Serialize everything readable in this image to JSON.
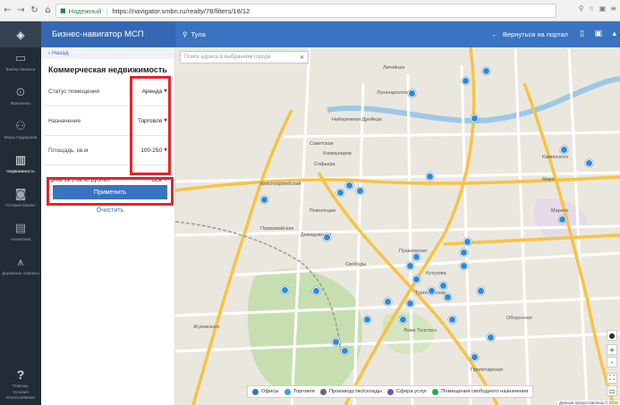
{
  "browser": {
    "secure_label": "Надежный",
    "url": "https://navigator.smbn.ru/realty/78/filters/18/12"
  },
  "rail": {
    "items": [
      {
        "label": "Выбор бизнеса",
        "icon": "briefcase-icon"
      },
      {
        "label": "Франшизы",
        "icon": "franchise-icon"
      },
      {
        "label": "Меры поддержки",
        "icon": "support-icon"
      },
      {
        "label": "Недвижимость",
        "icon": "building-icon"
      },
      {
        "label": "Готовый бизнес",
        "icon": "ready-business-icon"
      },
      {
        "label": "Аналитика",
        "icon": "analytics-icon"
      },
      {
        "label": "Дорожные сервисы",
        "icon": "road-icon"
      }
    ],
    "help_label": "Помощь",
    "terms_label": "Условия использования"
  },
  "appbar": {
    "title": "Бизнес-навигатор МСП",
    "city": "Тула",
    "back_label": "Вернуться на портал"
  },
  "panel": {
    "back_label": "Назад",
    "heading": "Коммерческая недвижимость",
    "filters": [
      {
        "label": "Статус помещения",
        "value": "Аренда"
      },
      {
        "label": "Назначение",
        "value": "Торговля"
      },
      {
        "label": "Площадь, кв.м",
        "value": "100-250"
      },
      {
        "label": "Цена за 1 кв.м, рублей",
        "value": "Все"
      }
    ],
    "apply_label": "Применить",
    "clear_label": "Очистить"
  },
  "map": {
    "search_placeholder": "Поиск адреса в выбранном городе",
    "streets": [
      "Литейная",
      "Луначарского",
      "Набережная Дрейера",
      "Коммунаров",
      "Советская",
      "Софьера",
      "Красноармейский",
      "Революции",
      "Демидовская",
      "Первомайская",
      "Свободы",
      "Пушкинская",
      "Кутузова",
      "Оборонная",
      "Каминского",
      "Тургеневская",
      "Мира",
      "Жуковского",
      "Пролетарская",
      "Марата",
      "Ложа Толстого"
    ],
    "legend": [
      {
        "label": "Офисы",
        "color": "#3a73c0"
      },
      {
        "label": "Торговля",
        "color": "#2ea6e0"
      },
      {
        "label": "Производство/склады",
        "color": "#6b6b6b"
      },
      {
        "label": "Сфера услуг",
        "color": "#7b4fb0"
      },
      {
        "label": "Помещения свободного назначения",
        "color": "#2aa84a"
      }
    ],
    "attribution": "Данные предоставлены © 2GIS"
  }
}
